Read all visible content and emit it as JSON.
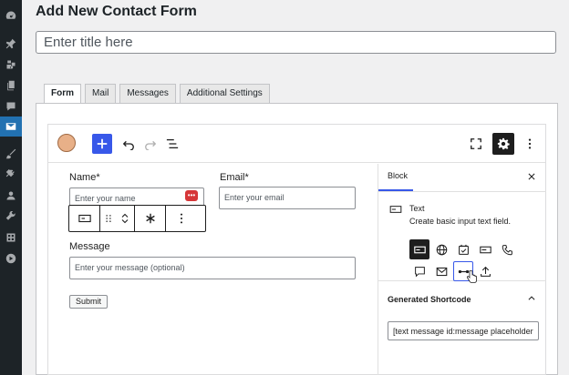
{
  "page": {
    "heading": "Add New Contact Form"
  },
  "title_input": {
    "placeholder": "Enter title here",
    "value": ""
  },
  "admin_menu": [
    {
      "icon": "dashboard-icon"
    },
    {
      "icon": "pin-icon"
    },
    {
      "icon": "media-icon"
    },
    {
      "icon": "pages-icon"
    },
    {
      "icon": "comments-icon"
    },
    {
      "icon": "envelope-icon",
      "active": true
    },
    {
      "icon": "appearance-icon"
    },
    {
      "icon": "plugins-icon"
    },
    {
      "icon": "users-icon"
    },
    {
      "icon": "tools-icon"
    },
    {
      "icon": "settings-icon"
    },
    {
      "icon": "play-icon"
    }
  ],
  "tabs": [
    {
      "label": "Form",
      "active": true
    },
    {
      "label": "Mail"
    },
    {
      "label": "Messages"
    },
    {
      "label": "Additional Settings"
    }
  ],
  "form": {
    "name_label": "Name*",
    "name_placeholder": "Enter your name",
    "email_label": "Email*",
    "email_placeholder": "Enter your email",
    "message_label": "Message",
    "message_placeholder": "Enter your message (optional)",
    "submit_label": "Submit",
    "badge_text": "•••"
  },
  "sidebar": {
    "tab_label": "Block",
    "block_name": "Text",
    "block_description": "Create basic input text field.",
    "shortcode_title": "Generated Shortcode",
    "shortcode_value": "[text message id:message placeholder \"Enter your message (optional)\"]"
  },
  "colors": {
    "accent": "#3858e9",
    "admin_bg": "#1d2327",
    "admin_active": "#2271b1",
    "badge": "#d63638"
  }
}
